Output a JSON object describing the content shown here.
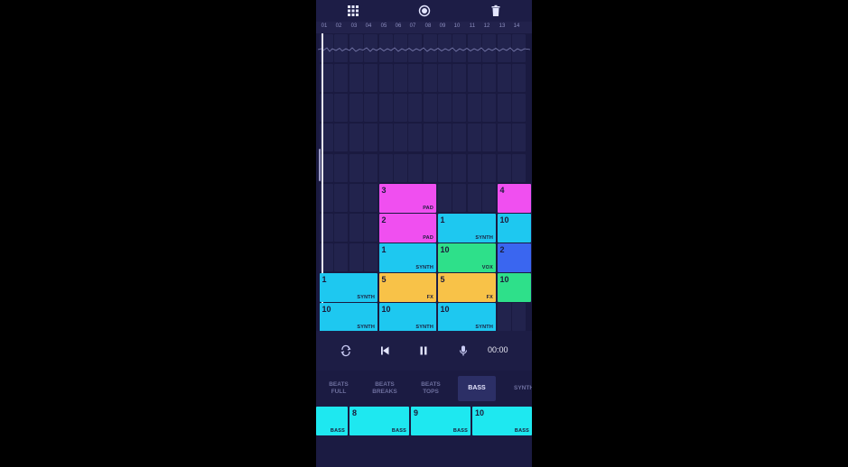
{
  "app": {
    "toolbar_icons": [
      "grid-icon",
      "record-icon",
      "trash-icon"
    ]
  },
  "ruler": [
    "01",
    "02",
    "03",
    "04",
    "05",
    "06",
    "07",
    "08",
    "09",
    "10",
    "11",
    "12",
    "13",
    "14"
  ],
  "clips": [
    {
      "row": 5,
      "col": 4,
      "span": 4,
      "num": "3",
      "label": "PAD",
      "color": "#f04ff0"
    },
    {
      "row": 5,
      "col": 12,
      "span": 3,
      "num": "4",
      "label": "",
      "color": "#f04ff0"
    },
    {
      "row": 6,
      "col": 4,
      "span": 4,
      "num": "2",
      "label": "PAD",
      "color": "#f04ff0"
    },
    {
      "row": 6,
      "col": 8,
      "span": 4,
      "num": "1",
      "label": "SYNTH",
      "color": "#1ec8f0"
    },
    {
      "row": 6,
      "col": 12,
      "span": 3,
      "num": "10",
      "label": "",
      "color": "#1ec8f0"
    },
    {
      "row": 7,
      "col": 4,
      "span": 4,
      "num": "1",
      "label": "SYNTH",
      "color": "#1ec8f0"
    },
    {
      "row": 7,
      "col": 8,
      "span": 4,
      "num": "10",
      "label": "VOX",
      "color": "#2ee08a"
    },
    {
      "row": 7,
      "col": 12,
      "span": 3,
      "num": "2",
      "label": "",
      "color": "#3a66f0"
    },
    {
      "row": 8,
      "col": 0,
      "span": 4,
      "num": "1",
      "label": "SYNTH",
      "color": "#1ec8f0"
    },
    {
      "row": 8,
      "col": 4,
      "span": 4,
      "num": "5",
      "label": "FX",
      "color": "#f8c248"
    },
    {
      "row": 8,
      "col": 8,
      "span": 4,
      "num": "5",
      "label": "FX",
      "color": "#f8c248"
    },
    {
      "row": 8,
      "col": 12,
      "span": 3,
      "num": "10",
      "label": "",
      "color": "#2ee08a"
    },
    {
      "row": 9,
      "col": 0,
      "span": 4,
      "num": "10",
      "label": "SYNTH",
      "color": "#1ec8f0"
    },
    {
      "row": 9,
      "col": 4,
      "span": 4,
      "num": "10",
      "label": "SYNTH",
      "color": "#1ec8f0"
    },
    {
      "row": 9,
      "col": 8,
      "span": 4,
      "num": "10",
      "label": "SYNTH",
      "color": "#1ec8f0"
    }
  ],
  "transport": {
    "time": "00:00",
    "icons": [
      "loop-icon",
      "skip-back-icon",
      "pause-icon",
      "microphone-icon"
    ]
  },
  "tabs": [
    {
      "line1": "BEATS",
      "line2": "FULL",
      "active": false
    },
    {
      "line1": "BEATS",
      "line2": "BREAKS",
      "active": false
    },
    {
      "line1": "BEATS",
      "line2": "TOPS",
      "active": false
    },
    {
      "line1": "BASS",
      "line2": "",
      "active": true
    },
    {
      "line1": "SYNTH",
      "line2": "",
      "active": false
    }
  ],
  "pads": [
    {
      "num": "",
      "label": "BASS"
    },
    {
      "num": "8",
      "label": "BASS"
    },
    {
      "num": "9",
      "label": "BASS"
    },
    {
      "num": "10",
      "label": "BASS"
    }
  ],
  "colors": {
    "background": "#1b1b42",
    "pad": "#1ee8f0",
    "accent_active_tab": "#2c2f66"
  }
}
